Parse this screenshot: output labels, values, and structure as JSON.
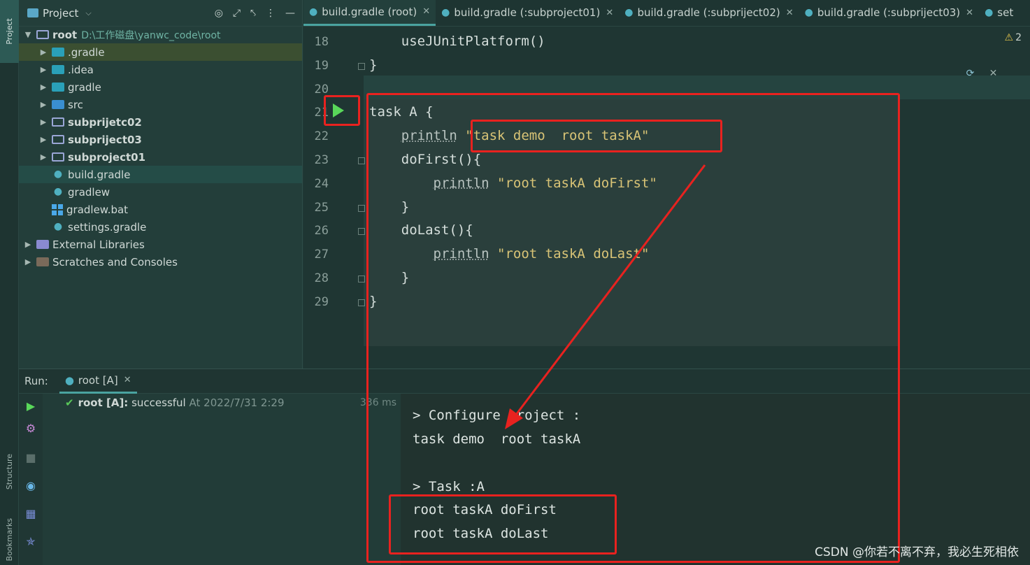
{
  "left_strip": {
    "project_tab": "Project",
    "structure_tab": "Structure",
    "bookmarks_tab": "Bookmarks"
  },
  "project_panel": {
    "title": "Project",
    "tree": [
      {
        "label": "root",
        "path": "D:\\工作磁盘\\yanwc_code\\root",
        "icon": "folder-icon",
        "expanded": true,
        "bold": true
      },
      {
        "label": ".gradle",
        "icon": "gradle-folder-icon",
        "expanded": false,
        "selected": true
      },
      {
        "label": ".idea",
        "icon": "idea-folder-icon",
        "expanded": false
      },
      {
        "label": "gradle",
        "icon": "gradle-folder-icon",
        "expanded": false
      },
      {
        "label": "src",
        "icon": "source-folder-icon",
        "expanded": false
      },
      {
        "label": "subprijetc02",
        "icon": "module-folder-icon",
        "expanded": false,
        "bold": true
      },
      {
        "label": "subpriject03",
        "icon": "module-folder-icon",
        "expanded": false,
        "bold": true
      },
      {
        "label": "subproject01",
        "icon": "module-folder-icon",
        "expanded": false,
        "bold": true
      },
      {
        "label": "build.gradle",
        "icon": "gradle-file-icon",
        "current": true
      },
      {
        "label": "gradlew",
        "icon": "gradle-file-icon"
      },
      {
        "label": "gradlew.bat",
        "icon": "windows-file-icon"
      },
      {
        "label": "settings.gradle",
        "icon": "gradle-file-icon"
      },
      {
        "label": "External Libraries",
        "icon": "libraries-icon",
        "expanded": false
      },
      {
        "label": "Scratches and Consoles",
        "icon": "scratches-icon",
        "expanded": false
      }
    ]
  },
  "editor_tabs": [
    {
      "label": "build.gradle (root)",
      "active": true
    },
    {
      "label": "build.gradle (:subproject01)"
    },
    {
      "label": "build.gradle (:subpriject02)"
    },
    {
      "label": "build.gradle (:subpriject03)"
    },
    {
      "label": "set"
    }
  ],
  "editor": {
    "warnings_count": "2",
    "lines": [
      {
        "num": "18",
        "code": "    useJUnitPlatform()"
      },
      {
        "num": "19",
        "code": "}"
      },
      {
        "num": "20",
        "code": ""
      },
      {
        "num": "21",
        "code": "task A {"
      },
      {
        "num": "22",
        "code": "    println \"task demo  root taskA\""
      },
      {
        "num": "23",
        "code": "    doFirst(){"
      },
      {
        "num": "24",
        "code": "        println \"root taskA doFirst\""
      },
      {
        "num": "25",
        "code": "    }"
      },
      {
        "num": "26",
        "code": "    doLast(){"
      },
      {
        "num": "27",
        "code": "        println \"root taskA doLast\""
      },
      {
        "num": "28",
        "code": "    }"
      },
      {
        "num": "29",
        "code": "}"
      }
    ]
  },
  "run_panel": {
    "label": "Run:",
    "tab": "root [A]",
    "result_task": "root [A]:",
    "result_status": "successful",
    "result_time": "At 2022/7/31 2:29",
    "duration": "336 ms",
    "console": [
      "> Configure project :",
      "task demo  root taskA",
      "",
      "> Task :A",
      "root taskA doFirst",
      "root taskA doLast"
    ]
  },
  "watermark": "CSDN @你若不离不弃，我必生死相依",
  "colors": {
    "accent": "#4aa3a0",
    "annotation_red": "#e8221f",
    "success_green": "#59c859",
    "string": "#d9c476"
  }
}
